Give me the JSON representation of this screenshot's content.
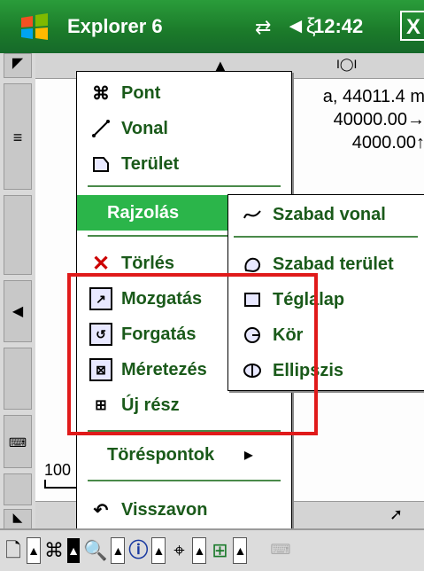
{
  "title_bar": {
    "app_name": "Explorer 6",
    "time": "12:42",
    "close_label": "X"
  },
  "map": {
    "coord_x_text": "a, 44011.4 m",
    "coord_y_text": "40000.00→",
    "coord_z_text": "4000.00↑",
    "scale_label": "100"
  },
  "main_menu": {
    "items": [
      {
        "label": "Pont",
        "icon": "point-icon"
      },
      {
        "label": "Vonal",
        "icon": "line-icon"
      },
      {
        "label": "Terület",
        "icon": "area-icon"
      },
      {
        "label": "Rajzolás",
        "icon": "",
        "highlighted": true,
        "has_submenu": true
      },
      {
        "label": "Törlés",
        "icon": "delete-icon"
      },
      {
        "label": "Mozgatás",
        "icon": "move-icon"
      },
      {
        "label": "Forgatás",
        "icon": "rotate-icon"
      },
      {
        "label": "Méretezés",
        "icon": "resize-icon"
      },
      {
        "label": "Új rész",
        "icon": "new-part-icon"
      },
      {
        "label": "Töréspontok",
        "icon": "",
        "has_submenu": true
      },
      {
        "label": "Visszavon",
        "icon": "undo-icon"
      }
    ]
  },
  "sub_menu": {
    "items": [
      {
        "label": "Szabad vonal",
        "icon": "freehand-line-icon"
      },
      {
        "label": "Szabad terület",
        "icon": "freehand-area-icon"
      },
      {
        "label": "Téglalap",
        "icon": "rectangle-icon"
      },
      {
        "label": "Kör",
        "icon": "circle-icon"
      },
      {
        "label": "Ellipszis",
        "icon": "ellipse-icon"
      }
    ]
  },
  "colors": {
    "title_bar": "#1b7a2a",
    "highlight": "#2bb54a",
    "menu_text": "#1a5a1a",
    "annotation_box": "#e01a1a"
  }
}
